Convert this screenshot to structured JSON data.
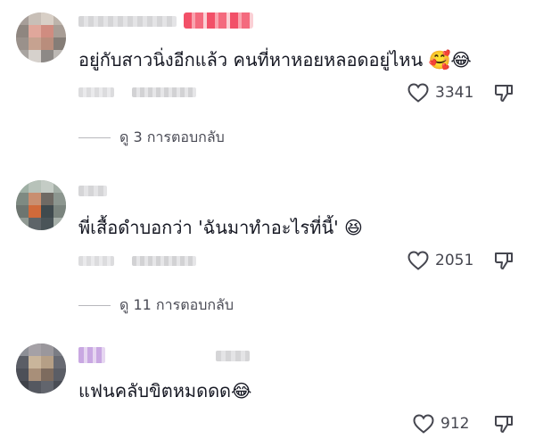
{
  "comments": [
    {
      "text": "อยู่กับสาวนิ่งอีกแล้ว คนที่หาหอยหลอดอยู่ไหน",
      "emojis": [
        "🥰",
        "😂"
      ],
      "likes": "3341",
      "replies_label": "ดู 3 การตอบกลับ"
    },
    {
      "text": "พี่เสื้อดำบอกว่า 'ฉันมาทำอะไรที่นี้'",
      "emojis": [
        "😆"
      ],
      "likes": "2051",
      "replies_label": "ดู 11 การตอบกลับ"
    },
    {
      "text": "แฟนคลับขิตหมดดด",
      "emojis": [
        "😂"
      ],
      "likes": "912"
    }
  ],
  "icons": {
    "like": "heart-outline-icon",
    "dislike": "thumbs-down-outline-icon"
  },
  "colors": {
    "text": "#161823",
    "meta": "#45464f",
    "reaction_badge": "#fe2c55"
  }
}
